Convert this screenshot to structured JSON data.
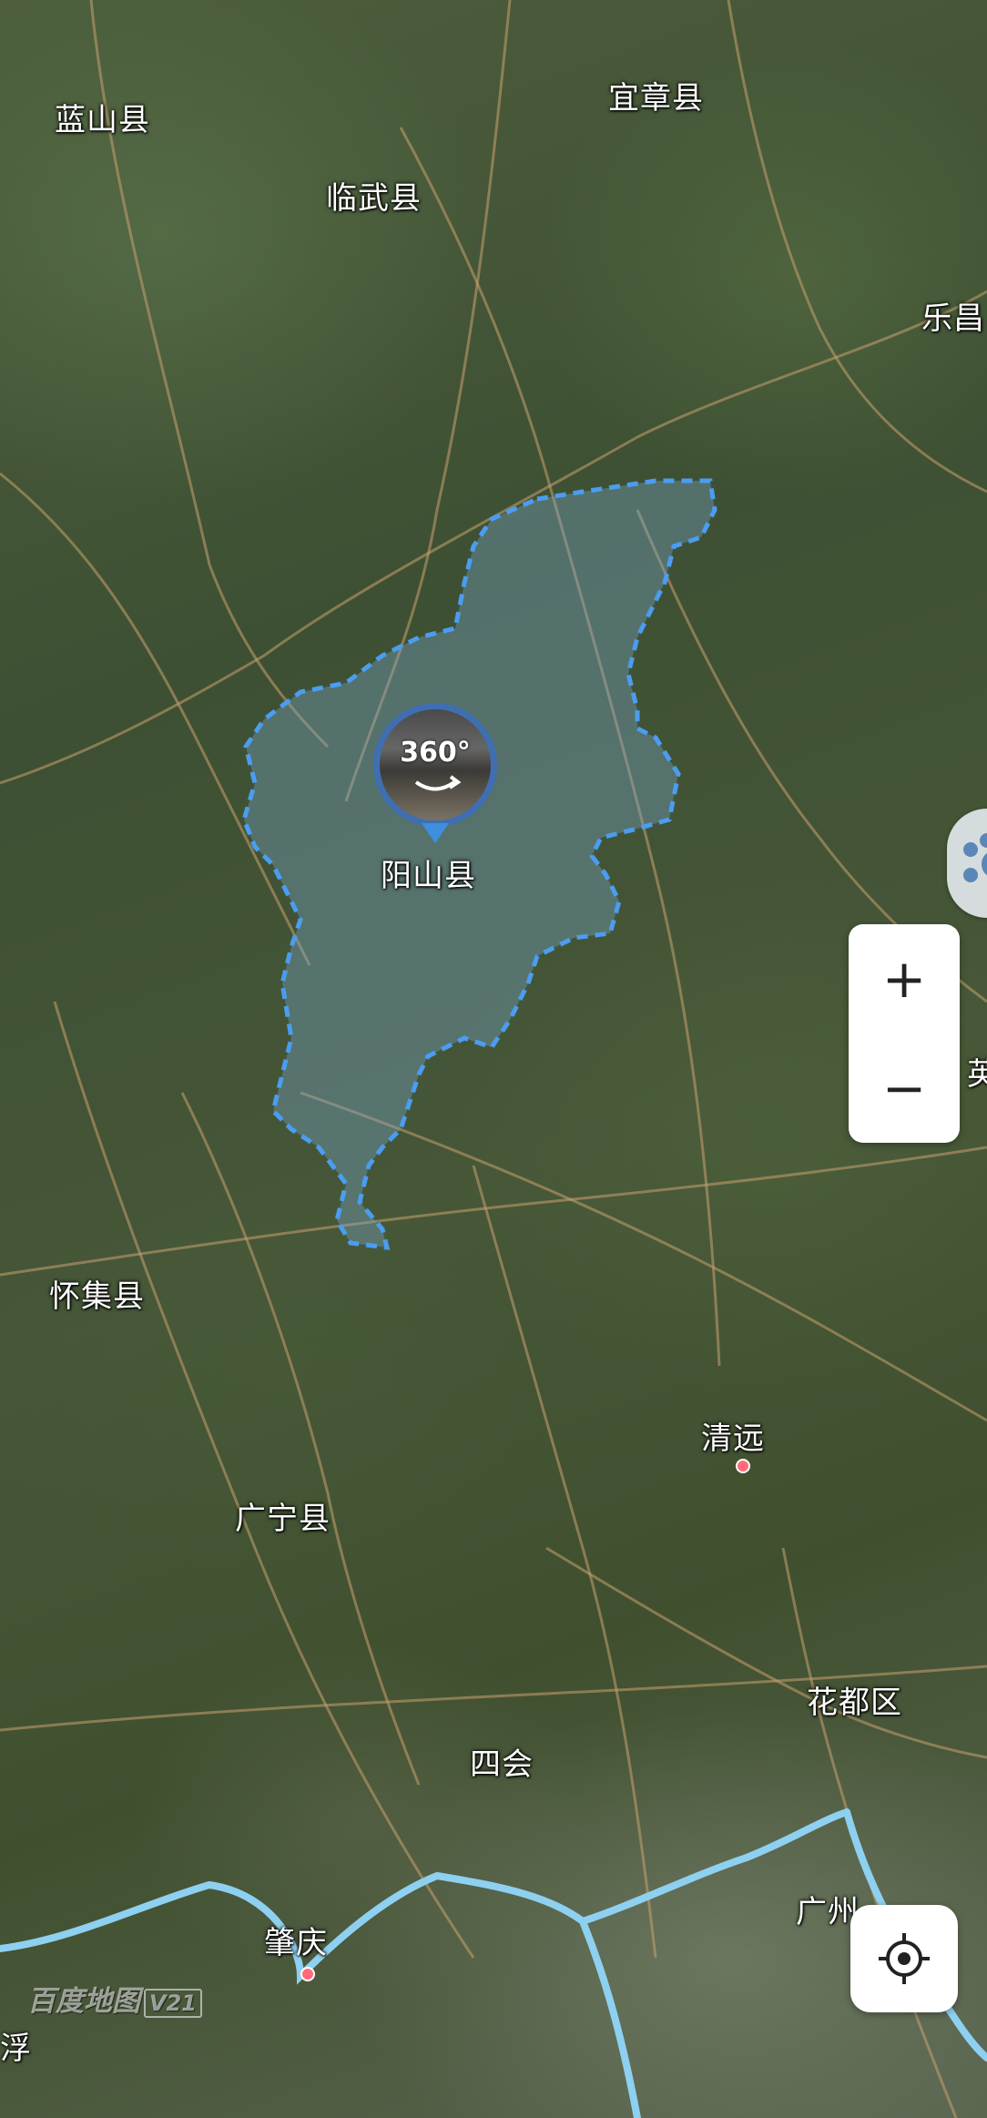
{
  "map": {
    "place_labels": [
      {
        "id": "lanshan",
        "text": "蓝山县"
      },
      {
        "id": "yizhang",
        "text": "宜章县"
      },
      {
        "id": "linwu",
        "text": "临武县"
      },
      {
        "id": "lechang",
        "text": "乐昌"
      },
      {
        "id": "yangshan",
        "text": "阳山县"
      },
      {
        "id": "huaiji",
        "text": "怀集县"
      },
      {
        "id": "qingyuan",
        "text": "清远"
      },
      {
        "id": "guangning",
        "text": "广宁县"
      },
      {
        "id": "huadu",
        "text": "花都区"
      },
      {
        "id": "sihui",
        "text": "四会"
      },
      {
        "id": "zhaoqing",
        "text": "肇庆"
      },
      {
        "id": "guangzhou",
        "text": "广州"
      },
      {
        "id": "fu",
        "text": "浮"
      },
      {
        "id": "ying",
        "text": "英"
      }
    ],
    "highlight_region": "阳山县",
    "region_border_color": "#4a9df0",
    "river_color": "#8ed0f0",
    "road_color": "#c8a070"
  },
  "panorama": {
    "label": "360°",
    "icon": "panorama-360-icon"
  },
  "controls": {
    "zoom_in_label": "+",
    "zoom_out_label": "−",
    "locate_icon": "locate-target-icon",
    "side_icon": "paw-icon"
  },
  "watermark": {
    "brand": "百度地图",
    "version": "V21"
  }
}
